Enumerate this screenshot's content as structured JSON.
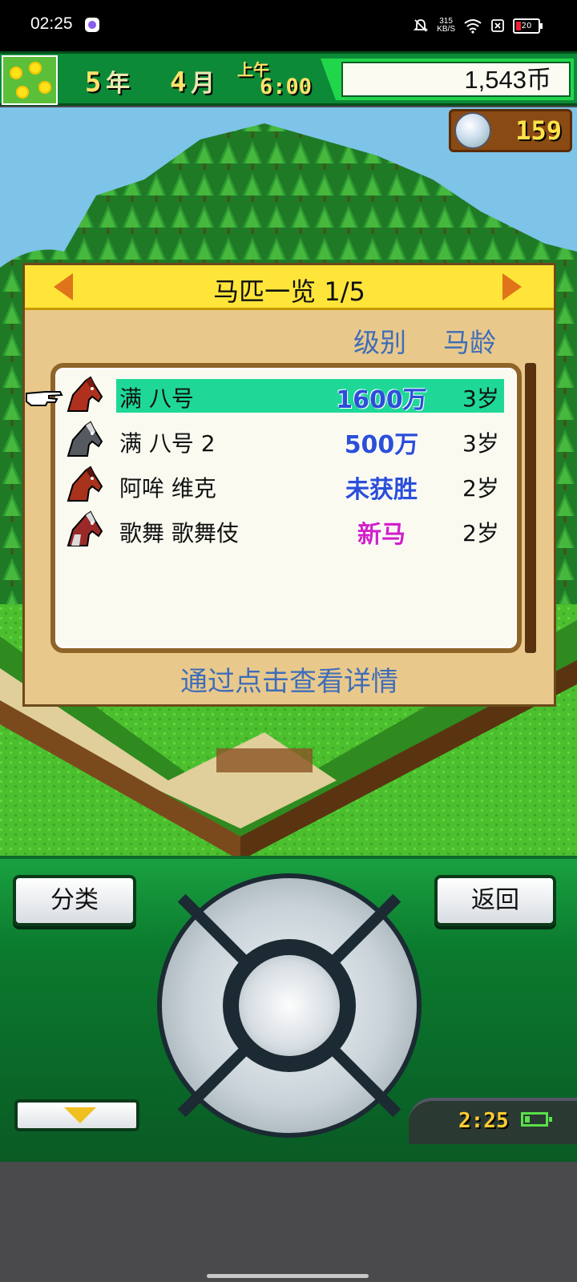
{
  "status_bar": {
    "time": "02:25",
    "net_speed_value": "315",
    "net_speed_unit": "KB/S",
    "battery_level": "20"
  },
  "hud": {
    "year_num": "5",
    "year_unit": "年",
    "month_num": "4",
    "month_unit": "月",
    "ampm": "上午",
    "clock": "6:00",
    "money": "1,543币",
    "medal_count": "159"
  },
  "panel": {
    "title": "马匹一览 1/5",
    "col_grade": "级别",
    "col_age": "马龄",
    "hint": "通过点击查看详情"
  },
  "horses": [
    {
      "name": "满 八号",
      "grade": "1600万",
      "age": "3岁",
      "selected": true,
      "grade_color": "#2b4fd8",
      "coat": "#b0301e",
      "mane": "#7a1a10"
    },
    {
      "name": "满 八号 2",
      "grade": "500万",
      "age": "3岁",
      "selected": false,
      "grade_color": "#2b4fd8",
      "coat": "#555a60",
      "mane": "#222"
    },
    {
      "name": "阿哞 维克",
      "grade": "未获胜",
      "age": "2岁",
      "selected": false,
      "grade_color": "#2b4fd8",
      "coat": "#a8321c",
      "mane": "#5a140a"
    },
    {
      "name": "歌舞 歌舞伎",
      "grade": "新马",
      "age": "2岁",
      "selected": false,
      "grade_color": "#d022c8",
      "coat": "#9a2a2a",
      "mane": "#ccc"
    }
  ],
  "controller": {
    "category_button": "分类",
    "back_button": "返回",
    "mini_time": "2:25"
  }
}
